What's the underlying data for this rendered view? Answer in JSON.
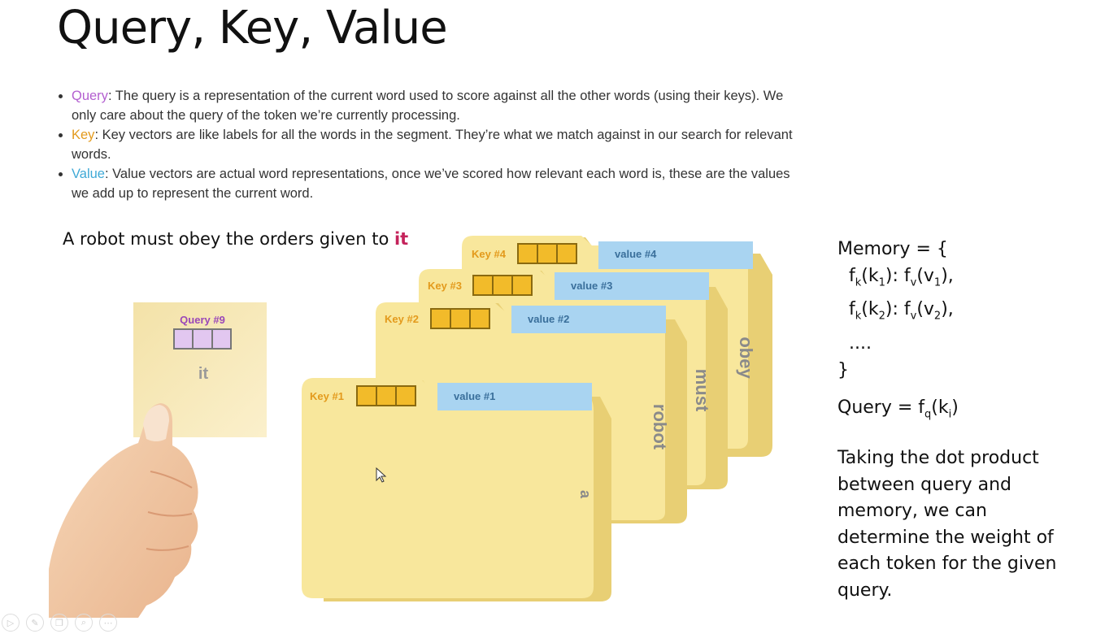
{
  "title": "Query, Key, Value",
  "bullets": [
    {
      "term": "Query",
      "text": ": The query is a representation of the current word used to score against all the other words (using their keys). We only care about the query of the token we’re currently processing."
    },
    {
      "term": "Key",
      "text": ": Key vectors are like labels for all the words in the segment. They’re what we match against in our search for relevant words."
    },
    {
      "term": "Value",
      "text": ": Value vectors are actual word representations, once we’ve scored how relevant each word is, these are the values we add up to represent the current word."
    }
  ],
  "sentence": {
    "prefix": "A robot must obey the orders given to ",
    "highlight": "it"
  },
  "query_card": {
    "label": "Query #9",
    "word": "it"
  },
  "folders": [
    {
      "key": "Key #4",
      "value": "value #4",
      "word": "obey"
    },
    {
      "key": "Key #3",
      "value": "value #3",
      "word": "must"
    },
    {
      "key": "Key #2",
      "value": "value #2",
      "word": "robot"
    },
    {
      "key": "Key #1",
      "value": "value #1",
      "word": "a"
    }
  ],
  "memory": {
    "open": "Memory = {",
    "entry1": " f(k): f(v),",
    "entry2": " f(k): f(v),",
    "dots": " ....",
    "close": "}"
  },
  "query_eq": "Query = f(k)",
  "explanation": "Taking the dot product between query and memory, we can determine the weight of each token for the given query.",
  "colors": {
    "query": "#b35fd0",
    "key": "#e39a1c",
    "value": "#3fa9d6",
    "highlight": "#c4235b",
    "folder": "#f8e79c",
    "folder_edge": "#e8cf74",
    "value_tab": "#a9d4f1"
  },
  "toolbar_icons": [
    "play-icon",
    "pen-icon",
    "copy-icon",
    "zoom-icon",
    "more-icon"
  ]
}
